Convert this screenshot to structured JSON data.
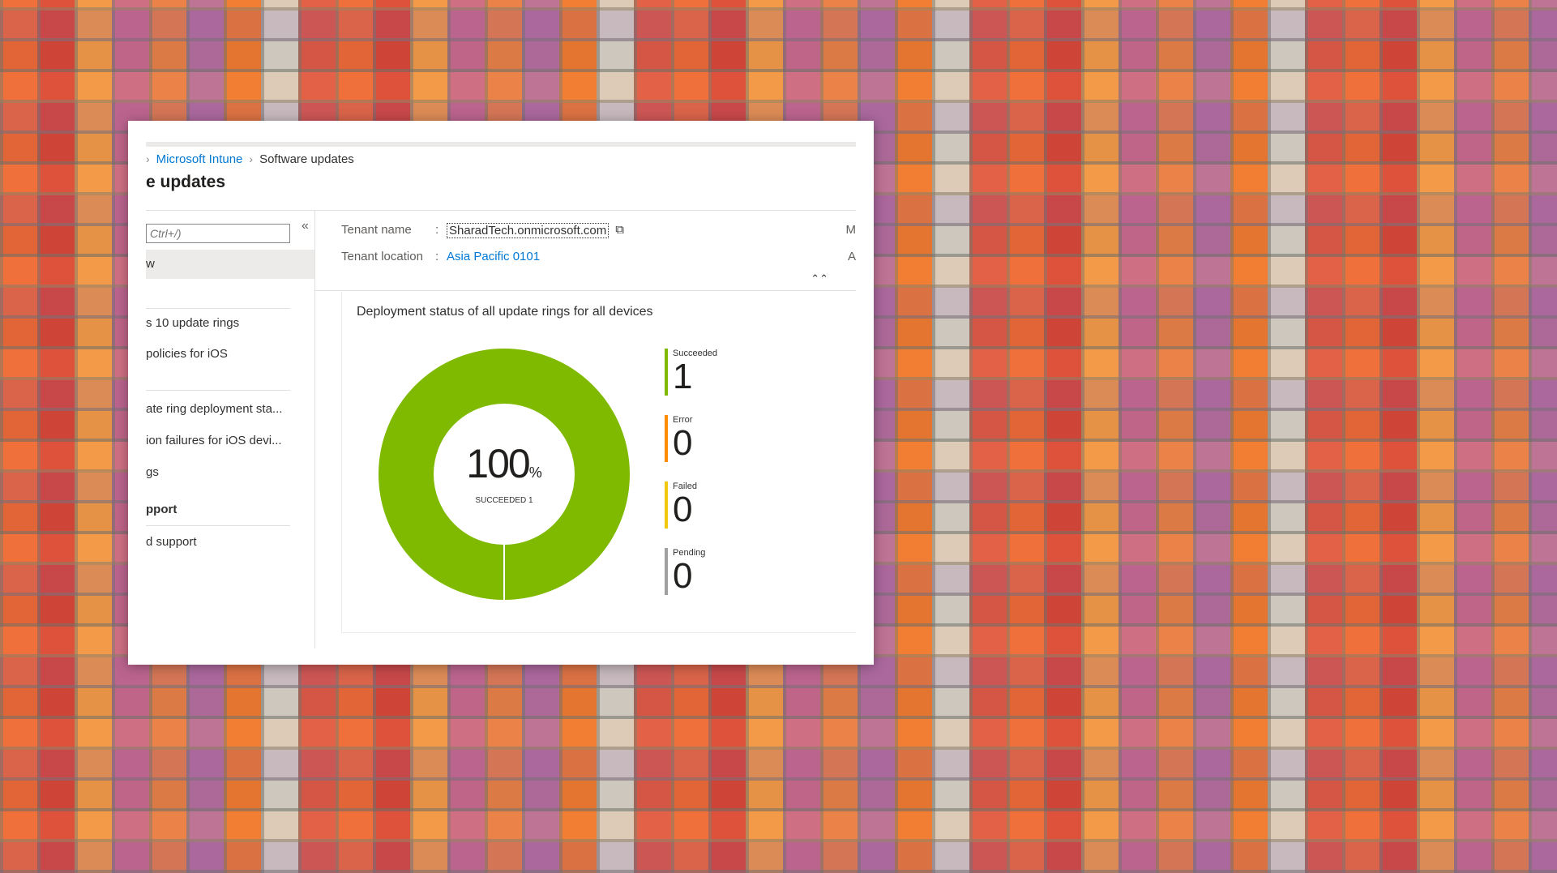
{
  "breadcrumb": {
    "root_chevron": "›",
    "items": [
      "Microsoft Intune",
      "Software updates"
    ]
  },
  "page_title": "e updates",
  "sidebar": {
    "search_placeholder": "Ctrl+/)",
    "collapse_glyph": "«",
    "items": [
      {
        "label": "w",
        "active": true
      },
      {
        "label": "s 10 update rings"
      },
      {
        "label": "policies for iOS"
      },
      {
        "label": "ate ring deployment sta..."
      },
      {
        "label": "ion failures for iOS devi..."
      },
      {
        "label": "gs"
      },
      {
        "label": "pport",
        "heading": true
      },
      {
        "label": "d support"
      }
    ]
  },
  "essentials": {
    "tenant_name_label": "Tenant name",
    "tenant_name_value": "SharadTech.onmicrosoft.com",
    "tenant_location_label": "Tenant location",
    "tenant_location_value": "Asia Pacific 0101",
    "colon": ":",
    "right_col_1": "M",
    "right_col_2": "A",
    "collapse_up_glyph": "⌃⌃"
  },
  "tile": {
    "title": "Deployment status of all update rings for all devices",
    "center_value": "100",
    "center_unit": "%",
    "center_caption": "SUCCEEDED 1",
    "legend": [
      {
        "label": "Succeeded",
        "value": "1",
        "color": "#7fba00"
      },
      {
        "label": "Error",
        "value": "0",
        "color": "#ff8c00"
      },
      {
        "label": "Failed",
        "value": "0",
        "color": "#f2c80f"
      },
      {
        "label": "Pending",
        "value": "0",
        "color": "#a0a0a0"
      }
    ]
  },
  "chart_data": {
    "type": "pie",
    "title": "Deployment status of all update rings for all devices",
    "categories": [
      "Succeeded",
      "Error",
      "Failed",
      "Pending"
    ],
    "values": [
      1,
      0,
      0,
      0
    ],
    "colors": [
      "#7fba00",
      "#ff8c00",
      "#f2c80f",
      "#a0a0a0"
    ],
    "donut": true
  }
}
